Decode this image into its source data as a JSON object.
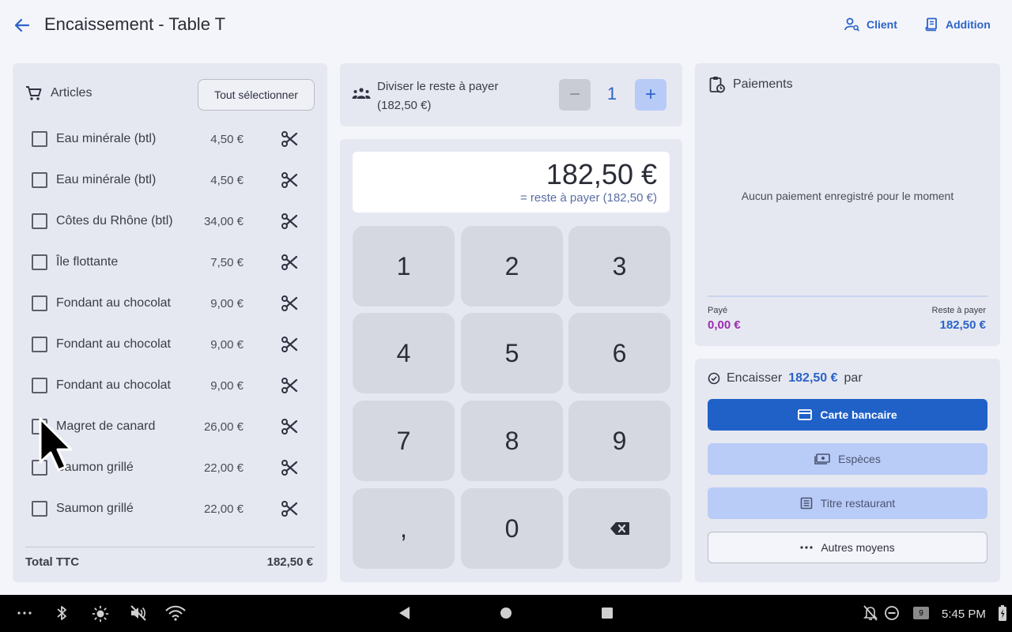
{
  "header": {
    "title": "Encaissement - Table T",
    "client_label": "Client",
    "addition_label": "Addition"
  },
  "articles": {
    "heading": "Articles",
    "select_all_label": "Tout sélectionner",
    "items": [
      {
        "name": "Eau minérale (btl)",
        "price": "4,50 €"
      },
      {
        "name": "Eau minérale (btl)",
        "price": "4,50 €"
      },
      {
        "name": "Côtes du Rhône (btl)",
        "price": "34,00 €"
      },
      {
        "name": "Île flottante",
        "price": "7,50 €"
      },
      {
        "name": "Fondant au chocolat",
        "price": "9,00 €"
      },
      {
        "name": "Fondant au chocolat",
        "price": "9,00 €"
      },
      {
        "name": "Fondant au chocolat",
        "price": "9,00 €"
      },
      {
        "name": "Magret de canard",
        "price": "26,00 €"
      },
      {
        "name": "Saumon grillé",
        "price": "22,00 €"
      },
      {
        "name": "Saumon grillé",
        "price": "22,00 €"
      }
    ],
    "total_label": "Total TTC",
    "total_value": "182,50 €"
  },
  "divide": {
    "label_line1": "Diviser le reste à payer",
    "label_line2": "(182,50 €)",
    "minus_label": "−",
    "plus_label": "+",
    "count": "1"
  },
  "keypad": {
    "amount": "182,50 €",
    "amount_note": "= reste à payer (182,50 €)",
    "keys": [
      "1",
      "2",
      "3",
      "4",
      "5",
      "6",
      "7",
      "8",
      "9",
      ",",
      "0",
      "backspace"
    ]
  },
  "payments": {
    "heading": "Paiements",
    "empty_text": "Aucun paiement enregistré pour le moment",
    "paid_label": "Payé",
    "paid_value": "0,00 €",
    "remaining_label": "Reste à payer",
    "remaining_value": "182,50 €"
  },
  "collect": {
    "prefix": "Encaisser",
    "amount": "182,50 €",
    "suffix": "par",
    "methods": {
      "card": "Carte bancaire",
      "cash": "Espèces",
      "ticket": "Titre restaurant",
      "other": "Autres moyens"
    }
  },
  "system_bar": {
    "time": "5:45 PM",
    "notification_count": "9"
  },
  "colors": {
    "accent": "#2b63c9",
    "primary_button": "#2061c7",
    "paid": "#9c2cae",
    "panel": "#e6e8f1",
    "background": "#f4f5fa"
  }
}
